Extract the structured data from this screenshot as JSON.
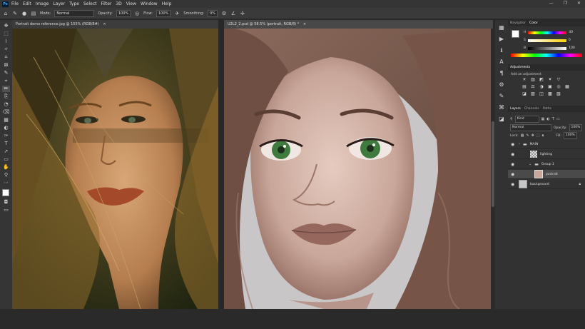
{
  "app": {
    "logo_label": "Ps"
  },
  "menu": [
    "File",
    "Edit",
    "Image",
    "Layer",
    "Type",
    "Select",
    "Filter",
    "3D",
    "View",
    "Window",
    "Help"
  ],
  "window_controls": {
    "minimize": "—",
    "restore": "❐",
    "close": "✕"
  },
  "options_bar": {
    "mode_label": "Mode:",
    "mode_value": "Normal",
    "opacity_label": "Opacity:",
    "opacity_value": "100%",
    "flow_label": "Flow:",
    "flow_value": "100%",
    "smoothing_label": "Smoothing:",
    "smoothing_value": "0%"
  },
  "documents": [
    {
      "title": "Portrait demo reference.jpg @ 155% (RGB/8#)",
      "close": "×"
    },
    {
      "title": "U2L2_2.psd @ 58.5% (portrait, RGB/8) *",
      "close": "×"
    }
  ],
  "tools": [
    "✥",
    "⬚",
    "⌇",
    "✧",
    "⌗",
    "⊠",
    "✎",
    "⌖",
    "✏",
    "⎘",
    "◔",
    "⌫",
    "▦",
    "◐",
    "✑",
    "T",
    "➚",
    "▭",
    "✋",
    "⚲",
    "⋯"
  ],
  "color_panel": {
    "tabs": [
      "Navigator",
      "Color"
    ],
    "channels": [
      {
        "label": "H",
        "value": "40"
      },
      {
        "label": "S",
        "value": "0"
      },
      {
        "label": "B",
        "value": "100"
      }
    ],
    "foreground_color": "#ffffff",
    "background_color": "#000000"
  },
  "adjustments_panel": {
    "title": "Adjustments",
    "subtitle": "Add an adjustment",
    "row1": [
      "☀",
      "▥",
      "◩",
      "✦",
      "▽"
    ],
    "row2": [
      "▤",
      "⚖",
      "◑",
      "▣",
      "◎",
      "▦"
    ],
    "row3": [
      "◪",
      "▨",
      "◫",
      "▩",
      "▧"
    ]
  },
  "layers_panel": {
    "tabs": [
      "Layers",
      "Channels",
      "Paths"
    ],
    "filter_label": "Kind",
    "blend_mode": "Normal",
    "opacity_label": "Opacity:",
    "opacity_value": "100%",
    "lock_label": "Lock:",
    "fill_label": "Fill:",
    "fill_value": "100%",
    "layers": [
      {
        "name": "MAIN",
        "type": "group",
        "indent": 0
      },
      {
        "name": "lighting",
        "type": "layer",
        "indent": 1
      },
      {
        "name": "Group 1",
        "type": "group",
        "indent": 1
      },
      {
        "name": "portrait",
        "type": "layer",
        "indent": 2,
        "selected": true
      },
      {
        "name": "background",
        "type": "layer",
        "indent": 0,
        "locked": true
      }
    ]
  },
  "right_strip_icons": [
    "▦",
    "▶",
    "ℹ",
    "A",
    "¶",
    "⚙",
    "✎",
    "⌘",
    "◪"
  ]
}
